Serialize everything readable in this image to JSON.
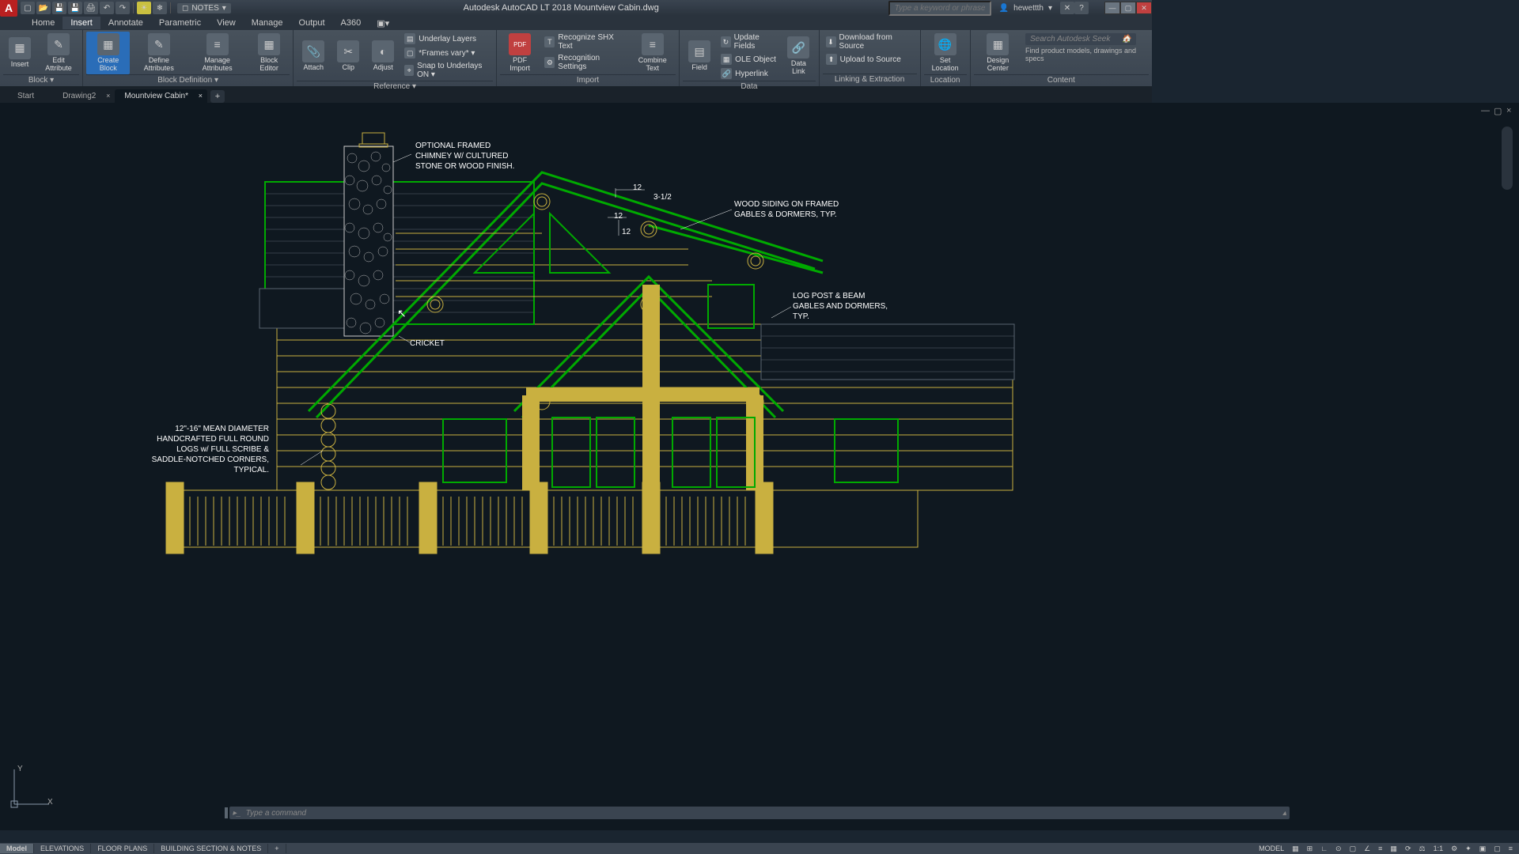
{
  "app": {
    "logo": "A",
    "title": "Autodesk AutoCAD LT 2018   Mountview Cabin.dwg"
  },
  "qat": {
    "layer": "NOTES"
  },
  "search": {
    "placeholder": "Type a keyword or phrase"
  },
  "user": {
    "name": "hewettth"
  },
  "menu": [
    "Home",
    "Insert",
    "Annotate",
    "Parametric",
    "View",
    "Manage",
    "Output",
    "A360"
  ],
  "menu_active": 1,
  "ribbon": {
    "panels": [
      {
        "title": "Block ▾",
        "big": [
          {
            "l": "Insert"
          },
          {
            "l": "Edit\nAttribute"
          }
        ]
      },
      {
        "title": "Block Definition ▾",
        "big": [
          {
            "l": "Create\nBlock",
            "hl": true
          },
          {
            "l": "Define\nAttributes"
          },
          {
            "l": "Manage\nAttributes"
          },
          {
            "l": "Block\nEditor"
          }
        ]
      },
      {
        "title": "Reference ▾",
        "big": [
          {
            "l": "Attach"
          },
          {
            "l": "Clip"
          },
          {
            "l": "Adjust"
          }
        ],
        "rows": [
          "Underlay Layers",
          "*Frames vary* ▾",
          "Snap to Underlays ON ▾"
        ]
      },
      {
        "title": "Import",
        "big": [
          {
            "l": "PDF\nImport"
          }
        ],
        "rows": [
          "Recognize SHX Text",
          "Recognition Settings"
        ],
        "big2": [
          {
            "l": "Combine\nText"
          }
        ]
      },
      {
        "title": "Data",
        "big": [
          {
            "l": "Field"
          }
        ],
        "rows": [
          "Update Fields",
          "OLE Object",
          "Hyperlink"
        ],
        "big2": [
          {
            "l": "Data\nLink"
          }
        ]
      },
      {
        "title": "Linking & Extraction",
        "rows": [
          "Download from Source",
          "Upload to Source"
        ]
      },
      {
        "title": "Location",
        "big": [
          {
            "l": "Set\nLocation"
          }
        ]
      },
      {
        "title": "",
        "big": [
          {
            "l": "Design\nCenter"
          }
        ]
      },
      {
        "title": "Content",
        "seek": "Search Autodesk Seek",
        "note": "Find product models, drawings and specs"
      }
    ]
  },
  "doc_tabs": [
    {
      "l": "Start"
    },
    {
      "l": "Drawing2"
    },
    {
      "l": "Mountview Cabin*",
      "active": true
    }
  ],
  "annotations": {
    "chimney": "OPTIONAL FRAMED\nCHIMNEY W/ CULTURED\nSTONE OR WOOD FINISH.",
    "siding": "WOOD SIDING ON FRAMED\nGABLES & DORMERS, TYP.",
    "post": "LOG POST & BEAM\nGABLES AND DORMERS,\nTYP.",
    "logs": "12\"-16\" MEAN DIAMETER\nHANDCRAFTED FULL ROUND\nLOGS w/ FULL SCRIBE &\nSADDLE-NOTCHED CORNERS,\nTYPICAL.",
    "cricket": "CRICKET",
    "d12a": "12",
    "d12b": "12",
    "d12c": "12",
    "pitch": "3-1/2"
  },
  "ucs": {
    "y": "Y",
    "x": "X"
  },
  "cmd": {
    "placeholder": "Type a command"
  },
  "layouts": [
    "Model",
    "ELEVATIONS",
    "FLOOR PLANS",
    "BUILDING SECTION & NOTES"
  ],
  "status": {
    "model": "MODEL",
    "scale": "1:1"
  }
}
